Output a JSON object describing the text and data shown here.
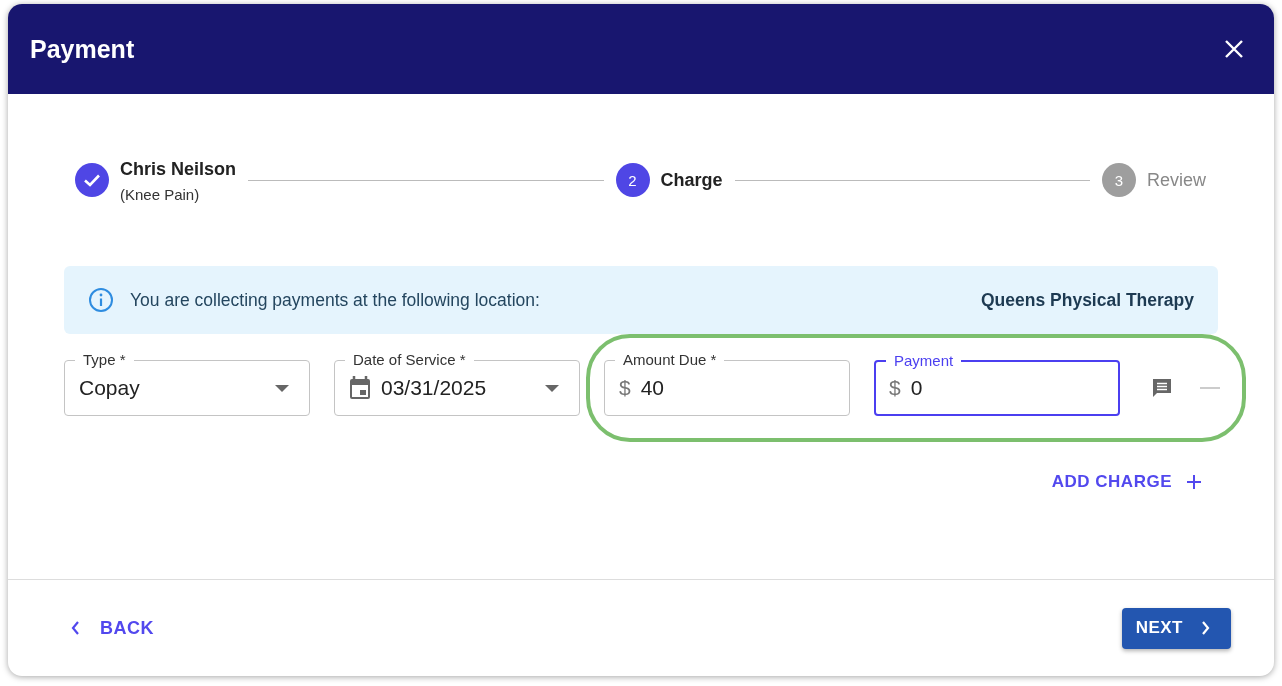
{
  "dialog": {
    "title": "Payment"
  },
  "steps": [
    {
      "kind": "completed",
      "label": "Chris Neilson",
      "sublabel": "(Knee Pain)"
    },
    {
      "kind": "active",
      "number": "2",
      "label": "Charge"
    },
    {
      "kind": "pending",
      "number": "3",
      "label": "Review"
    }
  ],
  "info": {
    "message": "You are collecting payments at the following location:",
    "location": "Queens Physical Therapy"
  },
  "fields": [
    {
      "kind": "select",
      "label": "Type *",
      "value": "Copay",
      "focused": false,
      "highlighted": false
    },
    {
      "kind": "date",
      "label": "Date of Service *",
      "value": "03/31/2025",
      "focused": false,
      "highlighted": false
    },
    {
      "kind": "currency",
      "label": "Amount Due *",
      "prefix": "$",
      "value": "40",
      "focused": false,
      "highlighted": true
    },
    {
      "kind": "currency",
      "label": "Payment",
      "prefix": "$",
      "value": "0",
      "focused": true,
      "highlighted": true
    }
  ],
  "add_charge": {
    "label": "ADD CHARGE"
  },
  "footer": {
    "back": "BACK",
    "next": "NEXT"
  }
}
